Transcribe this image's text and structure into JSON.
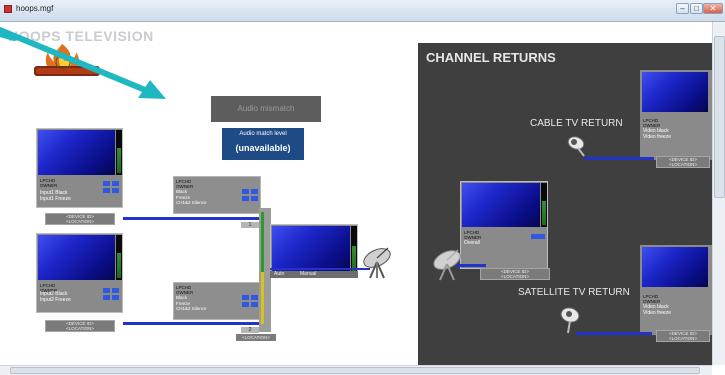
{
  "window": {
    "title": "hoops.mgf"
  },
  "brand": {
    "title": "HOOPS TELEVISION"
  },
  "main": {
    "audio_mismatch": "Audio mismatch",
    "audio_level_label": "Audio match level",
    "audio_level_value": "(unavailable)"
  },
  "sources": [
    {
      "tag": "LPCHD\nOWNER",
      "status": "Input1 Black\nInput1 Freeze",
      "device": "<DEVICE ID>\n<LOCATION>"
    },
    {
      "tag": "LPCHD\nOWNER",
      "status": "Input2 Black\nInput2 Freeze",
      "device": "<DEVICE ID>\n<LOCATION>"
    }
  ],
  "processors": [
    {
      "tag": "LPCHD\nOWNER",
      "status": "Black\nFreeze\nCH1&2 Silence",
      "num": "1"
    },
    {
      "tag": "LPCHD\nOWNER",
      "status": "Black\nFreeze\nCH1&2 Silence",
      "num": "2"
    }
  ],
  "output": {
    "auto_label": "Auto",
    "manual_label": "Manual",
    "location": "<LOCATION>"
  },
  "channel_returns": {
    "title": "CHANNEL RETURNS",
    "cable_label": "CABLE TV RETURN",
    "satellite_label": "SATELLITE TV RETURN",
    "cable_monitor": {
      "tag": "LPCHD\nOWNER",
      "status": "Video black\nVideo freeze",
      "device": "<DEVICE ID>\n<LOCATION>"
    },
    "center_monitor": {
      "tag": "LPCHD\nOWNER",
      "status": "Overall",
      "device": "<DEVICE ID>\n<LOCATION>"
    },
    "satellite_monitor": {
      "tag": "LPCHD\nOWNER",
      "status": "Video black\nVideo freeze",
      "device": "<DEVICE ID>\n<LOCATION>"
    }
  },
  "colors": {
    "accent": "#1fb8c2",
    "signal_blue": "#2233cc",
    "level_panel": "#1e4a86",
    "returns_bg": "#3f3f3f"
  },
  "icons": [
    "satellite-dish-icon",
    "camera-icon",
    "arrow-icon",
    "logo-flame-icon"
  ]
}
